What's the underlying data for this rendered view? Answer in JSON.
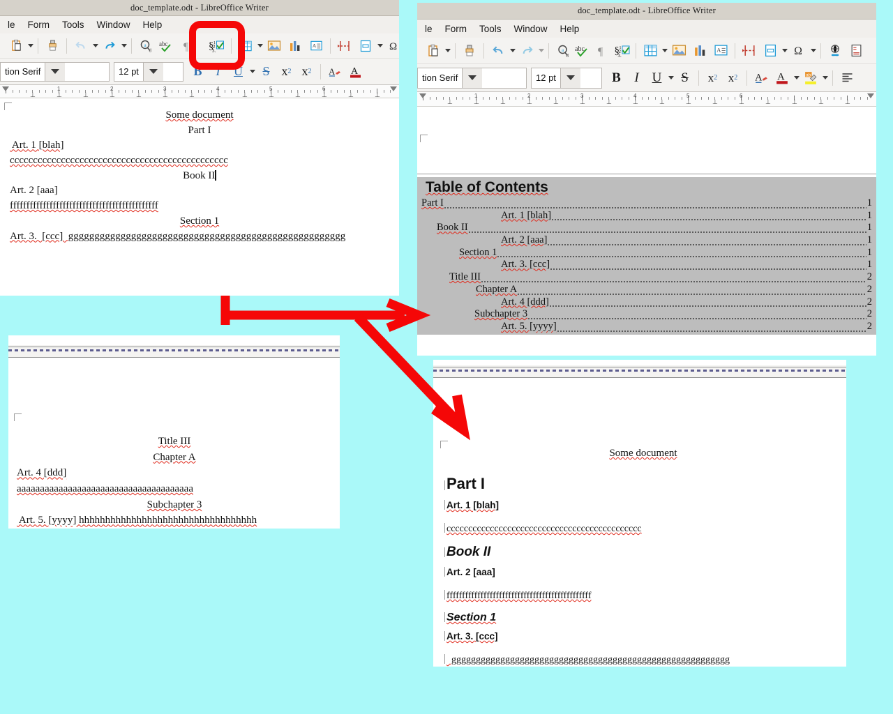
{
  "app": {
    "title": "doc_template.odt - LibreOffice Writer",
    "menu_left": [
      "le",
      "Form",
      "Tools",
      "Window",
      "Help"
    ],
    "menu_right": [
      "le",
      "Form",
      "Tools",
      "Window",
      "Help"
    ]
  },
  "toolbar": {
    "font_name": "tion Serif",
    "font_size": "12 pt",
    "icons": [
      "paste-icon",
      "clone-formatting-icon",
      "undo-icon",
      "redo-icon",
      "find-and-replace-icon",
      "spelling-icon",
      "formatting-marks-icon",
      "insert-table-of-contents-icon",
      "insert-table-icon",
      "insert-image-icon",
      "insert-chart-icon",
      "insert-text-box-icon",
      "page-break-icon",
      "insert-field-icon",
      "special-character-icon",
      "hyperlink-icon",
      "footnote-icon"
    ],
    "format_icons": [
      "bold-icon",
      "italic-icon",
      "underline-icon",
      "strikethrough-icon",
      "superscript-icon",
      "subscript-icon",
      "clear-formatting-icon",
      "font-color-icon",
      "highlight-color-icon",
      "align-left-icon"
    ],
    "format_labels": {
      "bold": "B",
      "italic": "I",
      "underline": "U",
      "strike": "S",
      "superscript": "x",
      "superscript_sup": "2",
      "subscript": "x",
      "subscript_sub": "2",
      "clear": "A",
      "font_color": "A"
    }
  },
  "ruler": {
    "numbers": [
      "1",
      "2",
      "3",
      "4",
      "5",
      "6"
    ]
  },
  "annotation": {
    "color": "#f50707",
    "highlight_target": "insert-table-of-contents-icon",
    "arrow_1": "arrow-to-toc-window",
    "arrow_2": "arrow-to-styled-document"
  },
  "doc_plain_page1": {
    "lines": [
      {
        "text": "Some document",
        "align": "center",
        "spell": true
      },
      {
        "text": "Part I",
        "align": "center",
        "spell": false
      },
      {
        "text": " Art. 1 [blah]",
        "align": "left",
        "spell": true
      },
      {
        "text": "ccccccccccccccccccccccccccccccccccccccccccccccc",
        "align": "left",
        "spell": true
      },
      {
        "text": "Book II",
        "align": "center",
        "spell": false,
        "cursor": true
      },
      {
        "text": "Art. 2 [aaa]",
        "align": "left",
        "spell": false
      },
      {
        "text": "fffffffffffffffffffffffffffffffffffffffffffff",
        "align": "left",
        "spell": true
      },
      {
        "text": "Section 1",
        "align": "center",
        "spell": true
      },
      {
        "text": "Art. 3.  [ccc]  ggggggggggggggggggggggggggggggggggggggggggggggggggggg",
        "align": "left",
        "spell": true
      }
    ]
  },
  "doc_plain_page2": {
    "lines": [
      {
        "text": "Title III",
        "align": "center",
        "spell": true
      },
      {
        "text": "Chapter A",
        "align": "center",
        "spell": true
      },
      {
        "text": "Art. 4 [ddd]",
        "align": "left",
        "spell": true
      },
      {
        "text": "aaaaaaaaaaaaaaaaaaaaaaaaaaaaaaaaaaaaaa",
        "align": "left",
        "spell": true
      },
      {
        "text": "Subchapter 3",
        "align": "center",
        "spell": true
      },
      {
        "text": " Art. 5. [yyyy] hhhhhhhhhhhhhhhhhhhhhhhhhhhhhhhhhh",
        "align": "left",
        "spell": true
      }
    ]
  },
  "toc": {
    "heading": "Table of Contents",
    "entries": [
      {
        "label": "Part I",
        "page": "1",
        "indent": 0
      },
      {
        "label": "Art. 1 [blah]",
        "page": "1",
        "indent": 114
      },
      {
        "label": "Book II",
        "page": "1",
        "indent": 22
      },
      {
        "label": "Art. 2 [aaa]",
        "page": "1",
        "indent": 114
      },
      {
        "label": "Section 1",
        "page": "1",
        "indent": 54
      },
      {
        "label": "Art. 3. [ccc]",
        "page": "1",
        "indent": 114
      },
      {
        "label": "Title III",
        "page": "2",
        "indent": 40
      },
      {
        "label": "Chapter A",
        "page": "2",
        "indent": 78
      },
      {
        "label": "Art. 4 [ddd]",
        "page": "2",
        "indent": 114
      },
      {
        "label": "Subchapter 3",
        "page": "2",
        "indent": 76
      },
      {
        "label": "Art. 5. [yyyy]",
        "page": "2",
        "indent": 114
      }
    ]
  },
  "doc_styled": {
    "lines": [
      {
        "text": "Some document",
        "style": "title",
        "align": "center",
        "spell": true
      },
      {
        "text": "Part I",
        "style": "h1",
        "align": "left",
        "spell": false
      },
      {
        "text": "Art. 1 [blah]",
        "style": "h4",
        "align": "left",
        "spell": true
      },
      {
        "text": "ccccccccccccccccccccccccccccccccccccccccccccc",
        "style": "body",
        "align": "left",
        "spell": true
      },
      {
        "text": "Book II",
        "style": "h2",
        "align": "left",
        "spell": false
      },
      {
        "text": "Art. 2 [aaa]",
        "style": "h4",
        "align": "left",
        "spell": false
      },
      {
        "text": "fffffffffffffffffffffffffffffffffffffffffffffff",
        "style": "body",
        "align": "left",
        "spell": true
      },
      {
        "text": "Section 1",
        "style": "h3",
        "align": "left",
        "spell": true
      },
      {
        "text": "Art. 3.  [ccc]",
        "style": "h4",
        "align": "left",
        "spell": true
      },
      {
        "text": "  ggggggggggggggggggggggggggggggggggggggggggggggggggggggggg",
        "style": "body",
        "align": "left",
        "spell": true
      }
    ]
  },
  "colors": {
    "desktop": "#aaf9f9",
    "annotation_red": "#f50707",
    "toc_field_shading": "#bdbdbd",
    "titlebar": "#d6d2ca"
  }
}
